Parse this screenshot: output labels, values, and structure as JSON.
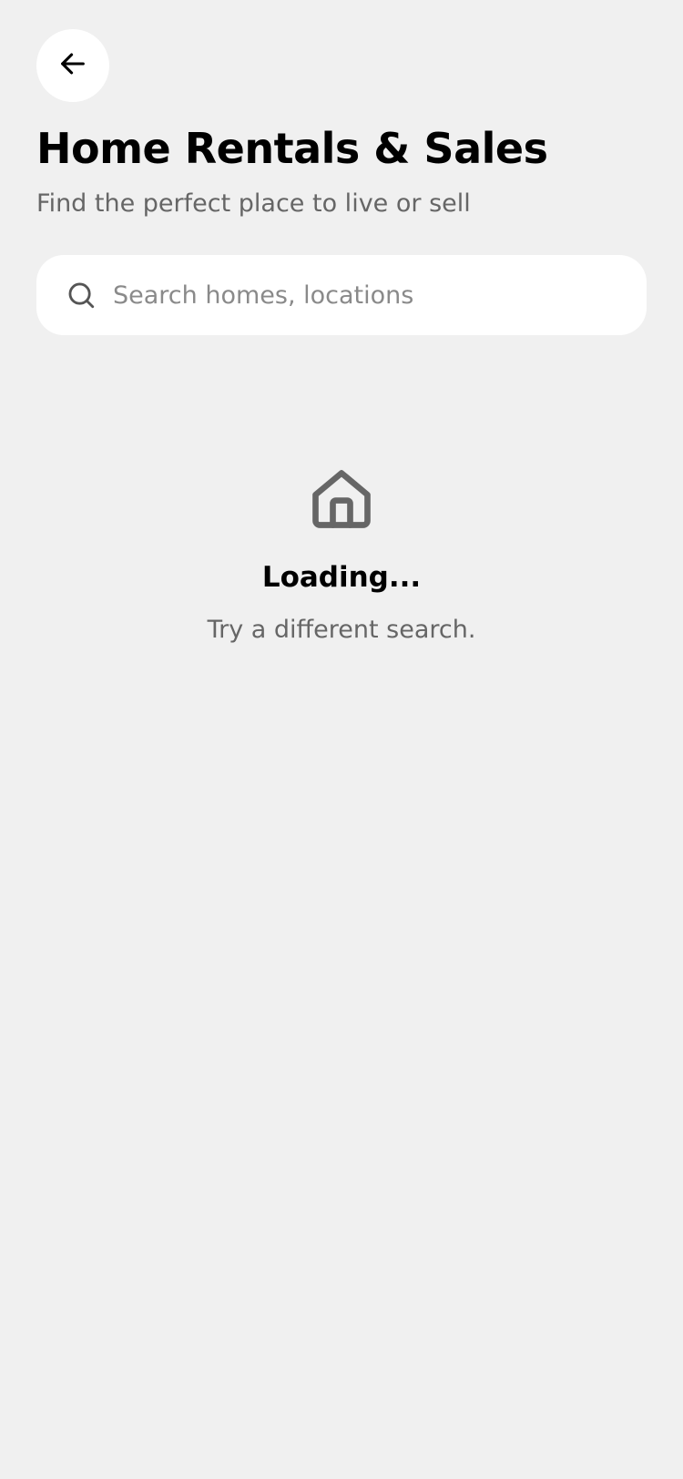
{
  "header": {
    "back_icon": "arrow-left-icon",
    "title": "Home Rentals & Sales",
    "subtitle": "Find the perfect place to live or sell"
  },
  "search": {
    "icon": "search-icon",
    "placeholder": "Search homes, locations",
    "value": ""
  },
  "empty_state": {
    "icon": "home-icon",
    "title": "Loading...",
    "subtitle": "Try a different search."
  },
  "colors": {
    "background": "#f0f0f0",
    "surface": "#ffffff",
    "text_primary": "#000000",
    "text_secondary": "#666666",
    "icon_gray": "#666666"
  }
}
